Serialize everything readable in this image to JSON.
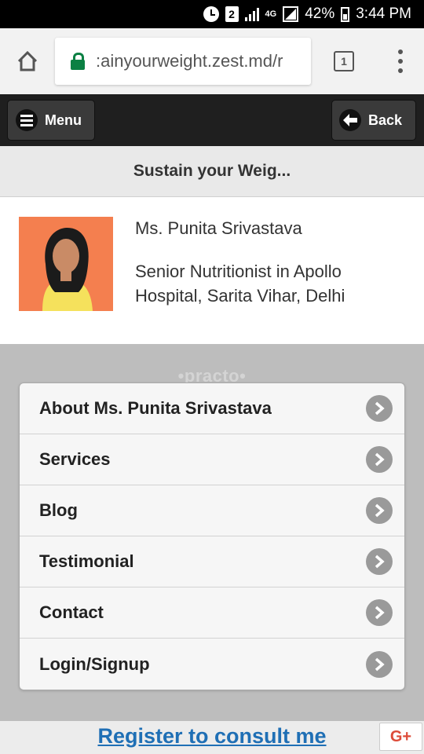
{
  "status_bar": {
    "sim_slot": "2",
    "network": "4G",
    "battery": "42%",
    "time": "3:44 PM"
  },
  "browser": {
    "url": ":ainyourweight.zest.md/r",
    "tab_count": "1"
  },
  "header": {
    "menu_label": "Menu",
    "back_label": "Back"
  },
  "page": {
    "title": "Sustain your Weig..."
  },
  "profile": {
    "name": "Ms. Punita Srivastava",
    "description": "Senior Nutritionist in Apollo Hospital, Sarita Vihar, Delhi"
  },
  "watermark": "•practo•",
  "menu_items": [
    {
      "label": "About Ms. Punita Srivastava"
    },
    {
      "label": "Services"
    },
    {
      "label": "Blog"
    },
    {
      "label": "Testimonial"
    },
    {
      "label": "Contact"
    },
    {
      "label": "Login/Signup"
    }
  ],
  "footer": {
    "register_label": "Register to consult me",
    "gplus_label": "G+"
  },
  "colors": {
    "appbar": "#1f1f1f",
    "link": "#1f6fb5",
    "gplus": "#dd4b39"
  }
}
